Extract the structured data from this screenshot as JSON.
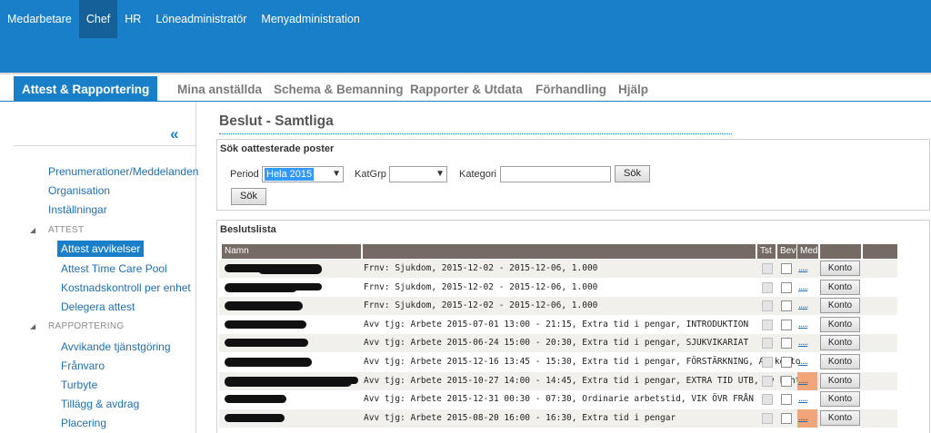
{
  "top_nav": [
    "Medarbetare",
    "Chef",
    "HR",
    "Löneadministratör",
    "Menyadministration"
  ],
  "top_nav_active": "Chef",
  "tabs": [
    "Attest & Rapportering",
    "Mina anställda",
    "Schema & Bemanning",
    "Rapporter & Utdata",
    "Förhandling",
    "Hjälp"
  ],
  "sidebar": {
    "collapse_icon": "«",
    "links_top": [
      "Prenumerationer/Meddelanden",
      "Organisation",
      "Inställningar"
    ],
    "group_attest": "ATTEST",
    "attest_items": [
      "Attest avvikelser",
      "Attest Time Care Pool",
      "Kostnadskontroll per enhet",
      "Delegera attest"
    ],
    "group_rapportering": "RAPPORTERING",
    "rapportering_items": [
      "Avvikande tjänstgöring",
      "Frånvaro",
      "Turbyte",
      "Tillägg & avdrag",
      "Placering"
    ]
  },
  "page_title": "Beslut - Samtliga",
  "search_panel": {
    "title": "Sök oattesterade poster",
    "period_label": "Period",
    "period_value": "Hela 2015",
    "katgrp_label": "KatGrp",
    "katgrp_value": "",
    "kategori_label": "Kategori",
    "kategori_value": "",
    "search_button": "Sök",
    "search_button_2": "Sök"
  },
  "list_panel": {
    "title": "Beslutslista",
    "columns": [
      "Namn",
      "",
      "Tst",
      "Bev",
      "Med",
      "",
      ""
    ],
    "rows": [
      {
        "desc": "Frnv: Sjukdom, 2015-12-02 - 2015-12-06, 1.000",
        "tst_disabled": true,
        "med_orange": false,
        "med_link": ".....",
        "konto": "Konto"
      },
      {
        "desc": "Frnv: Sjukdom, 2015-12-02 - 2015-12-06, 1.000",
        "tst_disabled": true,
        "med_orange": false,
        "med_link": ".....",
        "konto": "Konto"
      },
      {
        "desc": "Frnv: Sjukdom, 2015-12-02 - 2015-12-06, 1.000",
        "tst_disabled": true,
        "med_orange": false,
        "med_link": ".....",
        "konto": "Konto"
      },
      {
        "desc": "Avv tjg: Arbete 2015-07-01 13:00 - 21:15, Extra tid i pengar, INTRODUKTION",
        "tst_disabled": true,
        "med_orange": false,
        "med_link": ".....",
        "konto": "Konto"
      },
      {
        "desc": "Avv tjg: Arbete 2015-06-24 15:00 - 20:30, Extra tid i pengar, SJUKVIKARIAT",
        "tst_disabled": true,
        "med_orange": false,
        "med_link": ".....",
        "konto": "Konto"
      },
      {
        "desc": "Avv tjg: Arbete 2015-12-16 13:45 - 15:30, Extra tid i pengar, FÖRSTÄRKNING, Av konto",
        "tst_disabled": true,
        "med_orange": false,
        "med_link": ".....",
        "konto": "Konto"
      },
      {
        "desc": "Avv tjg: Arbete 2015-10-27 14:00 - 14:45, Extra tid i pengar, EXTRA TID UTB, Av konto",
        "tst_disabled": true,
        "med_orange": true,
        "med_link": ".....",
        "konto": "Konto"
      },
      {
        "desc": "Avv tjg: Arbete 2015-12-31 00:30 - 07:30, Ordinarie arbetstid, VIK ÖVR FRÅN",
        "tst_disabled": true,
        "med_orange": false,
        "med_link": ".....",
        "konto": "Konto"
      },
      {
        "desc": "Avv tjg: Arbete 2015-08-20 16:00 - 16:30, Extra tid i pengar",
        "tst_disabled": true,
        "med_orange": true,
        "med_link": ".....",
        "konto": "Konto"
      }
    ]
  },
  "colors": {
    "brand_blue": "#1a7fc9",
    "header_brown": "#766b64",
    "orange": "#f0a57a"
  }
}
